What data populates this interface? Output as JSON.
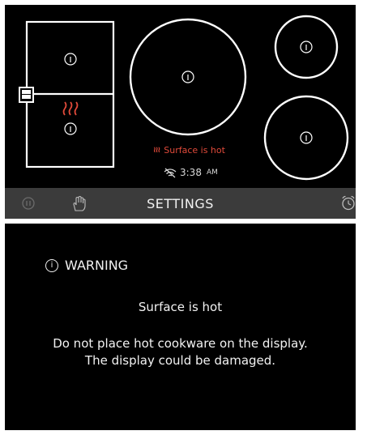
{
  "cooktop": {
    "status_text": "Surface is hot",
    "heat_icon": "heat-waves-icon",
    "time": "3:38",
    "time_suffix": "AM",
    "wifi_icon": "wifi-off-icon",
    "burner_icon": "info-icon",
    "hot_color": "#e04a3a"
  },
  "bar": {
    "settings_label": "SETTINGS",
    "left_icons": [
      "pause-icon",
      "hand-lock-icon"
    ],
    "right_icon": "timer-icon"
  },
  "warning": {
    "heading": "WARNING",
    "subtitle": "Surface is hot",
    "line1": "Do not place hot cookware on the display.",
    "line2": "The display could be damaged."
  }
}
